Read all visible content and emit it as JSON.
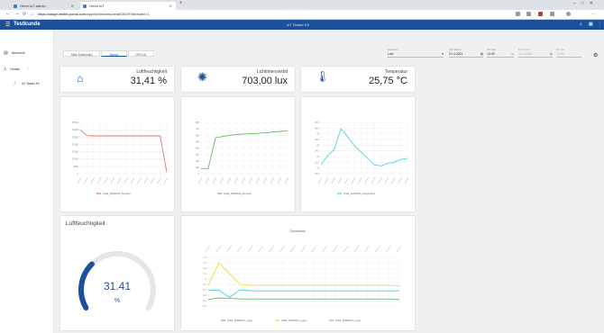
{
  "browser": {
    "tabs": [
      {
        "label": "Omni-IoT-admin"
      },
      {
        "label": "Omni-IoT"
      }
    ],
    "url_host": "https://stage.inhibit-portal.com",
    "url_path": "/app/iot/devices/detail/3029?tabindex=1"
  },
  "header": {
    "app_name": "Testkunde",
    "center_title": "IoT Starter Kit"
  },
  "sidebar": {
    "items": [
      {
        "label": "Übersicht",
        "icon": "grid-icon"
      },
      {
        "label": "Geräte",
        "icon": "devices-icon"
      }
    ],
    "sub_items": [
      {
        "label": "IoT Starter Kit"
      }
    ]
  },
  "tabs": [
    {
      "label": "Main Dashboard"
    },
    {
      "label": "Sensor"
    },
    {
      "label": "OPCUA"
    }
  ],
  "filters": {
    "zeitraum_label": "Zeitraum",
    "zeitraum_value": "Live",
    "von_datum_label": "Von Datum",
    "von_datum_value": "21.4.2021",
    "von_zeit_label": "Von Zeit",
    "von_zeit_value": "10:00",
    "bis_datum_label": "Bis Datum",
    "bis_datum_value": "21.4.2021",
    "bis_zeit_label": "Bis Zeit",
    "bis_zeit_value": "12:00"
  },
  "kpis": [
    {
      "label": "Luftfeuchtigkeit",
      "value": "31,41 %",
      "icon": "home-icon"
    },
    {
      "label": "Lichtintensivität",
      "value": "703,00 lux",
      "icon": "sun-icon"
    },
    {
      "label": "Temperatur",
      "value": "25,75 °C",
      "icon": "thermometer-icon"
    }
  ],
  "gauge": {
    "title": "Luftfeuchtigkeit",
    "value": "31.41",
    "unit": "%",
    "fraction": 0.3141,
    "color": "#1c4f9c"
  },
  "chart_data": [
    {
      "type": "line",
      "series": [
        {
          "name": "initial_30AW100_humidity",
          "color": "#e57373",
          "values": [
            30000,
            26000,
            25800,
            25800,
            25800,
            25800,
            25800,
            25800,
            25800,
            25800,
            25800,
            25800,
            25800,
            1000
          ]
        }
      ],
      "ylim": [
        0,
        35000
      ],
      "yticks": [
        "35000",
        "30000",
        "25000",
        "20000",
        "15000",
        "10000",
        "5000",
        "0"
      ]
    },
    {
      "type": "line",
      "series": [
        {
          "name": "initial_30AW100_luxmeter",
          "color": "#66bb6a",
          "values": [
            80,
            80,
            560,
            580,
            600,
            610,
            620,
            625,
            630,
            640,
            650,
            660,
            670
          ]
        }
      ],
      "ylim": [
        0,
        800
      ],
      "yticks": [
        "800",
        "700",
        "600",
        "500",
        "400",
        "300",
        "200",
        "100",
        "0"
      ]
    },
    {
      "type": "line",
      "series": [
        {
          "name": "initial_30AW100_temperature",
          "color": "#4dd0e1",
          "values": [
            23.6,
            24.3,
            24.8,
            26.4,
            25.8,
            25.1,
            24.6,
            24.1,
            23.6,
            23.5,
            23.7,
            23.8,
            24.0,
            24.1
          ]
        }
      ],
      "ylim": [
        22.9,
        26.9
      ],
      "yticks": [
        "26.9",
        "26.5",
        "26",
        "25.5",
        "25",
        "24.5",
        "24",
        "23.5",
        "23",
        "22.9"
      ]
    },
    {
      "type": "line",
      "title": "Gyrometrie",
      "ylim": [
        -0.5,
        0.4
      ],
      "yticks": [
        "0.4",
        "0.3",
        "0.2",
        "0.1",
        "0",
        "-0.1",
        "-0.2",
        "-0.3",
        "-0.4",
        "-0.5"
      ],
      "series": [
        {
          "name": "initial_30AW100_x-gyro",
          "color": "#66bb6a",
          "values": [
            -0.38,
            -0.35,
            -0.36,
            -0.37,
            -0.37,
            -0.37,
            -0.37,
            -0.37,
            -0.37,
            -0.37,
            -0.37,
            -0.37,
            -0.37,
            -0.37,
            -0.37,
            -0.37,
            -0.37,
            -0.37,
            -0.38
          ]
        },
        {
          "name": "initial_30AW100_y-gyro",
          "color": "#fdd835",
          "values": [
            -0.12,
            0.3,
            0.1,
            -0.1,
            -0.12,
            -0.12,
            -0.12,
            -0.12,
            -0.12,
            -0.12,
            -0.12,
            -0.12,
            -0.12,
            -0.12,
            -0.12,
            -0.12,
            -0.12,
            -0.12,
            -0.13
          ]
        },
        {
          "name": "initial_30AW100_z-gyro",
          "color": "#4dd0e1",
          "values": [
            -0.21,
            -0.21,
            -0.34,
            -0.2,
            -0.22,
            -0.22,
            -0.22,
            -0.22,
            -0.22,
            -0.22,
            -0.22,
            -0.22,
            -0.22,
            -0.22,
            -0.22,
            -0.22,
            -0.22,
            -0.22,
            -0.22
          ]
        }
      ]
    }
  ]
}
